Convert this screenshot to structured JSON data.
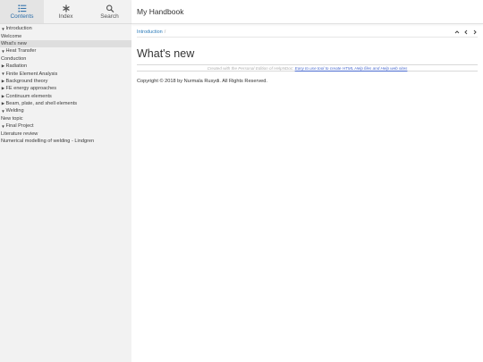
{
  "tabs": [
    {
      "label": "Contents",
      "icon": "list-icon",
      "active": true
    },
    {
      "label": "Index",
      "icon": "asterisk-icon",
      "active": false
    },
    {
      "label": "Search",
      "icon": "search-icon",
      "active": false
    }
  ],
  "tree": [
    {
      "label": "Introduction",
      "arrow": "down",
      "selected": false
    },
    {
      "label": "Welcome",
      "arrow": "",
      "selected": false
    },
    {
      "label": "What's new",
      "arrow": "",
      "selected": true
    },
    {
      "label": "Heat Transfer",
      "arrow": "down",
      "selected": false
    },
    {
      "label": "Conduction",
      "arrow": "",
      "selected": false
    },
    {
      "label": "Radiation",
      "arrow": "right",
      "selected": false
    },
    {
      "label": "Finite Element Analysis",
      "arrow": "down",
      "selected": false
    },
    {
      "label": "Background theory",
      "arrow": "right",
      "selected": false
    },
    {
      "label": "FE energy approaches",
      "arrow": "right",
      "selected": false
    },
    {
      "label": "Continuum elements",
      "arrow": "right",
      "selected": false
    },
    {
      "label": "Beam, plate, and shell elements",
      "arrow": "right",
      "selected": false
    },
    {
      "label": "Welding",
      "arrow": "down",
      "selected": false
    },
    {
      "label": "New topic",
      "arrow": "",
      "selected": false
    },
    {
      "label": "Final Project",
      "arrow": "down",
      "selected": false
    },
    {
      "label": "Literature review",
      "arrow": "",
      "selected": false
    },
    {
      "label": "Numerical modelling of welding - Lindgren",
      "arrow": "",
      "selected": false
    }
  ],
  "header": {
    "title": "My Handbook"
  },
  "breadcrumb": {
    "item": "Introduction",
    "sep": "/"
  },
  "main": {
    "page_title": "What's new",
    "created_prefix": "Created with the Personal Edition of HelpNDoc: ",
    "created_link": "Easy to use tool to create HTML Help files and Help web sites",
    "copyright": "Copyright © 2018 by Nurmala Rusydi. All Rights Reserved."
  },
  "colors": {
    "accent": "#2a7ab8",
    "sidebar_bg": "#f2f2f2",
    "link": "#4a6bd0"
  }
}
